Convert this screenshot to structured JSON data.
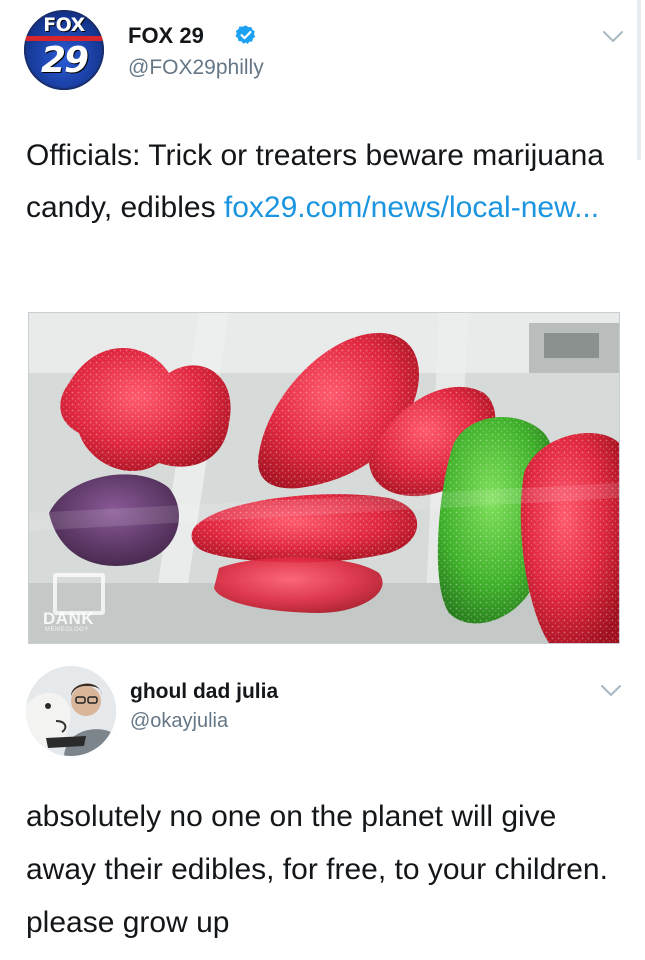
{
  "tweets": [
    {
      "display_name": "FOX 29",
      "handle": "@FOX29philly",
      "verified": true,
      "avatar": {
        "logo_word": "FOX",
        "logo_number": "29"
      },
      "text_before_link": "Officials: Trick or treaters beware marijuana candy, edibles ",
      "link_text": "fox29.com/news/local-new...",
      "media": {
        "description_icon": "sour-gummy-candy-photo",
        "watermark_title": "DANK",
        "watermark_subtitle": "MEMEOLOGY"
      },
      "menu_icon": "chevron-down-icon"
    },
    {
      "display_name": "ghoul dad julia",
      "handle": "@okayjulia",
      "verified": false,
      "text": "absolutely no one on the planet will give away their edibles, for free, to your children. please grow up",
      "menu_icon": "chevron-down-icon"
    }
  ],
  "colors": {
    "link": "#1b95e0",
    "handle": "#657786",
    "verified": "#1da1f2",
    "text": "#14171a"
  }
}
